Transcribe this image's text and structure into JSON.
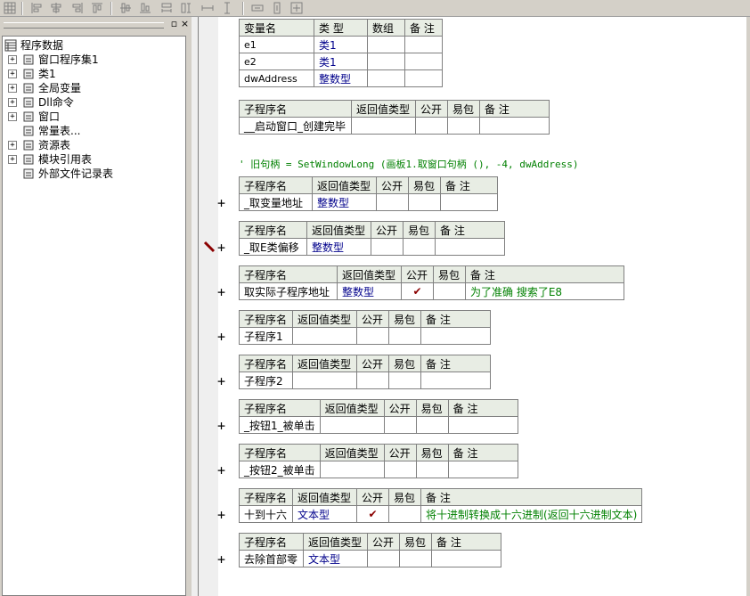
{
  "toolbar": {
    "icons": [
      "grid-icon",
      "align-left-icon",
      "align-center-icon",
      "align-right-icon",
      "align-top-icon",
      "align-middle-icon",
      "align-bottom-icon",
      "same-width-icon",
      "same-height-icon",
      "same-size-icon",
      "space-horizontal-icon",
      "space-vertical-icon",
      "center-icon"
    ]
  },
  "panel": {
    "pin_glyph": "▫",
    "close_glyph": "×"
  },
  "tree": {
    "root": "程序数据",
    "items": [
      {
        "label": "窗口程序集1",
        "icon": "assembly-icon",
        "expandable": true
      },
      {
        "label": "类1",
        "icon": "class-icon",
        "expandable": true
      },
      {
        "label": "全局变量",
        "icon": "global-var-icon",
        "expandable": true
      },
      {
        "label": "Dll命令",
        "icon": "dll-icon",
        "expandable": true
      },
      {
        "label": "窗口",
        "icon": "window-icon",
        "expandable": true
      },
      {
        "label": "常量表...",
        "icon": "constant-icon",
        "expandable": false
      },
      {
        "label": "资源表",
        "icon": "resource-icon",
        "expandable": true
      },
      {
        "label": "模块引用表",
        "icon": "module-icon",
        "expandable": true
      },
      {
        "label": "外部文件记录表",
        "icon": "file-icon",
        "expandable": false
      }
    ]
  },
  "vars_table": {
    "headers": [
      "变量名",
      "类 型",
      "数组",
      "备 注"
    ],
    "rows": [
      {
        "name": "e1",
        "type": "类1",
        "array": "",
        "note": ""
      },
      {
        "name": "e2",
        "type": "类1",
        "array": "",
        "note": ""
      },
      {
        "name": "dwAddress",
        "type": "整数型",
        "array": "",
        "note": ""
      }
    ]
  },
  "sub_headers": [
    "子程序名",
    "返回值类型",
    "公开",
    "易包",
    "备 注"
  ],
  "comment_line": "' 旧句柄 = SetWindowLong (画板1.取窗口句柄 (), -4, dwAddress)",
  "subs": [
    {
      "name": "__启动窗口_创建完毕",
      "ret": "",
      "public": "",
      "easy": "",
      "note": "",
      "plus": false
    },
    {
      "name": "_取变量地址",
      "ret": "整数型",
      "public": "",
      "easy": "",
      "note": "",
      "plus": true
    },
    {
      "name": "_取E类偏移",
      "ret": "整数型",
      "public": "",
      "easy": "",
      "note": "",
      "plus": true,
      "marker": true
    },
    {
      "name": "取实际子程序地址",
      "ret": "整数型",
      "public": "✔",
      "easy": "",
      "note": "为了准确 搜索了E8",
      "plus": true
    },
    {
      "name": "子程序1",
      "ret": "",
      "public": "",
      "easy": "",
      "note": "",
      "plus": true
    },
    {
      "name": "子程序2",
      "ret": "",
      "public": "",
      "easy": "",
      "note": "",
      "plus": true
    },
    {
      "name": "_按钮1_被单击",
      "ret": "",
      "public": "",
      "easy": "",
      "note": "",
      "plus": true
    },
    {
      "name": "_按钮2_被单击",
      "ret": "",
      "public": "",
      "easy": "",
      "note": "",
      "plus": true
    },
    {
      "name": "十到十六",
      "ret": "文本型",
      "public": "✔",
      "easy": "",
      "note": "将十进制转换成十六进制(返回十六进制文本)",
      "plus": true
    },
    {
      "name": "去除首部零",
      "ret": "文本型",
      "public": "",
      "easy": "",
      "note": "",
      "plus": true
    }
  ],
  "plus_glyph": "+",
  "colors": {
    "header_bg": "#e8ede4",
    "type_text": "#00008b",
    "note_text": "#008000",
    "check": "#8b0000"
  }
}
